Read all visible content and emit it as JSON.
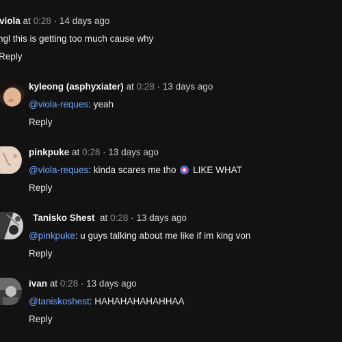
{
  "comments": [
    {
      "username": "viola",
      "at": "at",
      "timestamp": "0:28",
      "ago": "· 14 days ago",
      "mention": "",
      "text": "ngl this is getting too much cause why",
      "reply_label": "Reply"
    },
    {
      "username": "kyleong (asphyxiater)",
      "at": "at",
      "timestamp": "0:28",
      "ago": "· 13 days ago",
      "mention": "@viola-reques",
      "text": ": yeah",
      "reply_label": "Reply"
    },
    {
      "username": "pinkpuke",
      "at": "at",
      "timestamp": "0:28",
      "ago": "· 13 days ago",
      "mention": "@viola-reques",
      "text": ": kinda scares me tho",
      "text_after_emoji": "LIKE WHAT",
      "emoji_icon": "circle-emoji",
      "reply_label": "Reply"
    },
    {
      "username": "Tanisko Shest",
      "at": "at",
      "timestamp": "0:28",
      "ago": "· 13 days ago",
      "mention": "@pinkpuke",
      "text": ": u guys talking about me like if im king von",
      "reply_label": "Reply"
    },
    {
      "username": "ivan",
      "at": "at",
      "timestamp": "0:28",
      "ago": "· 13 days ago",
      "mention": "@taniskoshest",
      "text": ": HAHAHAHAHAHHAA",
      "reply_label": "Reply"
    }
  ],
  "colors": {
    "background": "#121212",
    "mention": "#6fa8ff",
    "timestamp": "#8a8a8a"
  }
}
